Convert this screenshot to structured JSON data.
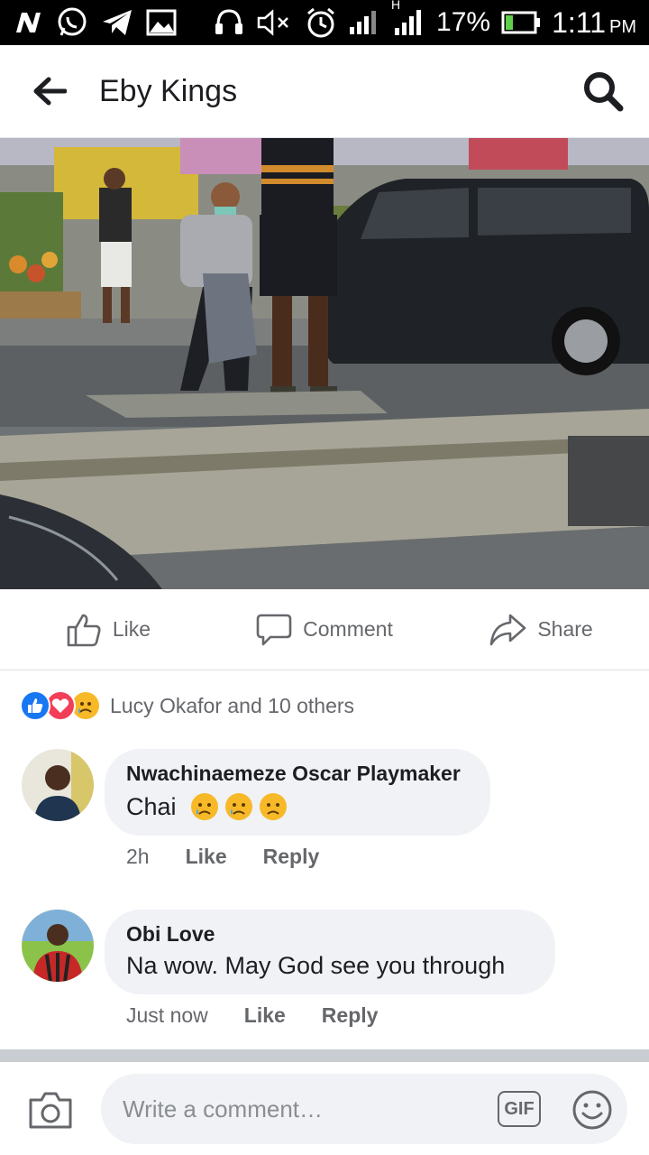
{
  "status_bar": {
    "carrier_icons": [
      "n-icon",
      "whatsapp-icon",
      "telegram-icon",
      "image-icon",
      "headset-icon",
      "mute-icon",
      "alarm-icon"
    ],
    "network": "H",
    "battery": "17%",
    "time": "1:11",
    "ampm": "PM"
  },
  "header": {
    "title": "Eby Kings"
  },
  "actions": {
    "like": "Like",
    "comment": "Comment",
    "share": "Share"
  },
  "reactions": {
    "types": [
      "like",
      "love",
      "sad"
    ],
    "summary": "Lucy Okafor and 10 others"
  },
  "comments": [
    {
      "author": "Nwachinaemeze Oscar Playmaker",
      "text": "Chai",
      "emoji_count": 3,
      "time": "2h",
      "like": "Like",
      "reply": "Reply"
    },
    {
      "author": "Obi Love",
      "text": "Na wow. May God see you through",
      "time": "Just now",
      "like": "Like",
      "reply": "Reply"
    }
  ],
  "composer": {
    "placeholder": "Write a comment…",
    "gif": "GIF"
  },
  "colors": {
    "brand": "#1877f2",
    "love": "#f33e58",
    "sad": "#f7b928",
    "bubble": "#f0f2f5",
    "secondary_text": "#65676b"
  }
}
